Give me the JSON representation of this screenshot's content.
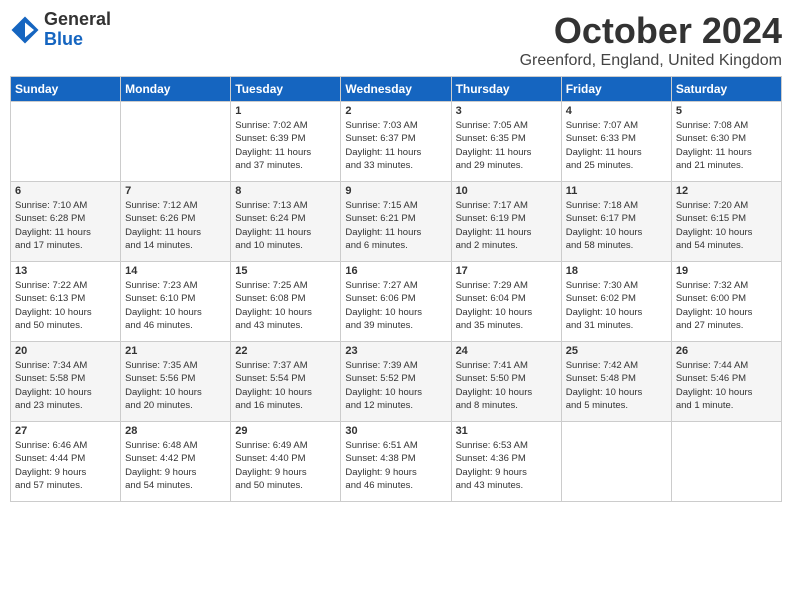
{
  "header": {
    "logo_general": "General",
    "logo_blue": "Blue",
    "month_title": "October 2024",
    "location": "Greenford, England, United Kingdom"
  },
  "days_of_week": [
    "Sunday",
    "Monday",
    "Tuesday",
    "Wednesday",
    "Thursday",
    "Friday",
    "Saturday"
  ],
  "weeks": [
    [
      {
        "day": "",
        "info": ""
      },
      {
        "day": "",
        "info": ""
      },
      {
        "day": "1",
        "info": "Sunrise: 7:02 AM\nSunset: 6:39 PM\nDaylight: 11 hours\nand 37 minutes."
      },
      {
        "day": "2",
        "info": "Sunrise: 7:03 AM\nSunset: 6:37 PM\nDaylight: 11 hours\nand 33 minutes."
      },
      {
        "day": "3",
        "info": "Sunrise: 7:05 AM\nSunset: 6:35 PM\nDaylight: 11 hours\nand 29 minutes."
      },
      {
        "day": "4",
        "info": "Sunrise: 7:07 AM\nSunset: 6:33 PM\nDaylight: 11 hours\nand 25 minutes."
      },
      {
        "day": "5",
        "info": "Sunrise: 7:08 AM\nSunset: 6:30 PM\nDaylight: 11 hours\nand 21 minutes."
      }
    ],
    [
      {
        "day": "6",
        "info": "Sunrise: 7:10 AM\nSunset: 6:28 PM\nDaylight: 11 hours\nand 17 minutes."
      },
      {
        "day": "7",
        "info": "Sunrise: 7:12 AM\nSunset: 6:26 PM\nDaylight: 11 hours\nand 14 minutes."
      },
      {
        "day": "8",
        "info": "Sunrise: 7:13 AM\nSunset: 6:24 PM\nDaylight: 11 hours\nand 10 minutes."
      },
      {
        "day": "9",
        "info": "Sunrise: 7:15 AM\nSunset: 6:21 PM\nDaylight: 11 hours\nand 6 minutes."
      },
      {
        "day": "10",
        "info": "Sunrise: 7:17 AM\nSunset: 6:19 PM\nDaylight: 11 hours\nand 2 minutes."
      },
      {
        "day": "11",
        "info": "Sunrise: 7:18 AM\nSunset: 6:17 PM\nDaylight: 10 hours\nand 58 minutes."
      },
      {
        "day": "12",
        "info": "Sunrise: 7:20 AM\nSunset: 6:15 PM\nDaylight: 10 hours\nand 54 minutes."
      }
    ],
    [
      {
        "day": "13",
        "info": "Sunrise: 7:22 AM\nSunset: 6:13 PM\nDaylight: 10 hours\nand 50 minutes."
      },
      {
        "day": "14",
        "info": "Sunrise: 7:23 AM\nSunset: 6:10 PM\nDaylight: 10 hours\nand 46 minutes."
      },
      {
        "day": "15",
        "info": "Sunrise: 7:25 AM\nSunset: 6:08 PM\nDaylight: 10 hours\nand 43 minutes."
      },
      {
        "day": "16",
        "info": "Sunrise: 7:27 AM\nSunset: 6:06 PM\nDaylight: 10 hours\nand 39 minutes."
      },
      {
        "day": "17",
        "info": "Sunrise: 7:29 AM\nSunset: 6:04 PM\nDaylight: 10 hours\nand 35 minutes."
      },
      {
        "day": "18",
        "info": "Sunrise: 7:30 AM\nSunset: 6:02 PM\nDaylight: 10 hours\nand 31 minutes."
      },
      {
        "day": "19",
        "info": "Sunrise: 7:32 AM\nSunset: 6:00 PM\nDaylight: 10 hours\nand 27 minutes."
      }
    ],
    [
      {
        "day": "20",
        "info": "Sunrise: 7:34 AM\nSunset: 5:58 PM\nDaylight: 10 hours\nand 23 minutes."
      },
      {
        "day": "21",
        "info": "Sunrise: 7:35 AM\nSunset: 5:56 PM\nDaylight: 10 hours\nand 20 minutes."
      },
      {
        "day": "22",
        "info": "Sunrise: 7:37 AM\nSunset: 5:54 PM\nDaylight: 10 hours\nand 16 minutes."
      },
      {
        "day": "23",
        "info": "Sunrise: 7:39 AM\nSunset: 5:52 PM\nDaylight: 10 hours\nand 12 minutes."
      },
      {
        "day": "24",
        "info": "Sunrise: 7:41 AM\nSunset: 5:50 PM\nDaylight: 10 hours\nand 8 minutes."
      },
      {
        "day": "25",
        "info": "Sunrise: 7:42 AM\nSunset: 5:48 PM\nDaylight: 10 hours\nand 5 minutes."
      },
      {
        "day": "26",
        "info": "Sunrise: 7:44 AM\nSunset: 5:46 PM\nDaylight: 10 hours\nand 1 minute."
      }
    ],
    [
      {
        "day": "27",
        "info": "Sunrise: 6:46 AM\nSunset: 4:44 PM\nDaylight: 9 hours\nand 57 minutes."
      },
      {
        "day": "28",
        "info": "Sunrise: 6:48 AM\nSunset: 4:42 PM\nDaylight: 9 hours\nand 54 minutes."
      },
      {
        "day": "29",
        "info": "Sunrise: 6:49 AM\nSunset: 4:40 PM\nDaylight: 9 hours\nand 50 minutes."
      },
      {
        "day": "30",
        "info": "Sunrise: 6:51 AM\nSunset: 4:38 PM\nDaylight: 9 hours\nand 46 minutes."
      },
      {
        "day": "31",
        "info": "Sunrise: 6:53 AM\nSunset: 4:36 PM\nDaylight: 9 hours\nand 43 minutes."
      },
      {
        "day": "",
        "info": ""
      },
      {
        "day": "",
        "info": ""
      }
    ]
  ]
}
